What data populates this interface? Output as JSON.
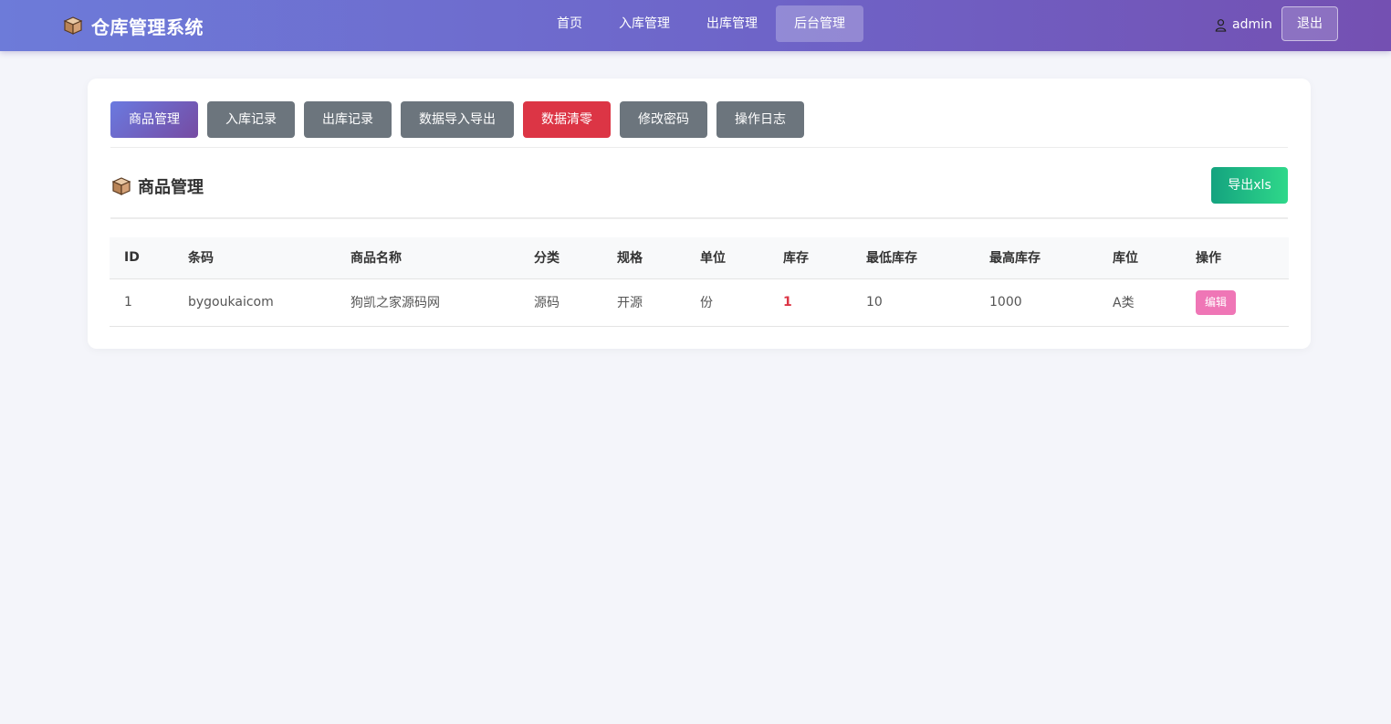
{
  "header": {
    "brand": "仓库管理系统",
    "nav": [
      "首页",
      "入库管理",
      "出库管理",
      "后台管理"
    ],
    "active_nav": "后台管理",
    "username": "admin",
    "logout": "退出"
  },
  "tabs": [
    {
      "label": "商品管理",
      "style": "active"
    },
    {
      "label": "入库记录",
      "style": "default"
    },
    {
      "label": "出库记录",
      "style": "default"
    },
    {
      "label": "数据导入导出",
      "style": "default"
    },
    {
      "label": "数据清零",
      "style": "danger"
    },
    {
      "label": "修改密码",
      "style": "default"
    },
    {
      "label": "操作日志",
      "style": "default"
    }
  ],
  "section": {
    "title": "商品管理",
    "export_label": "导出xls"
  },
  "table": {
    "columns": [
      "ID",
      "条码",
      "商品名称",
      "分类",
      "规格",
      "单位",
      "库存",
      "最低库存",
      "最高库存",
      "库位",
      "操作"
    ],
    "rows": [
      {
        "id": "1",
        "barcode": "bygoukaicom",
        "name": "狗凯之家源码网",
        "category": "源码",
        "spec": "开源",
        "unit": "份",
        "stock": "1",
        "min_stock": "10",
        "max_stock": "1000",
        "location": "A类",
        "action": "编辑"
      }
    ]
  },
  "colors": {
    "header_gradient_start": "#6d7bd9",
    "header_gradient_end": "#7450b2",
    "tab_default": "#6c757d",
    "tab_danger": "#dc3545",
    "export_green": "#20c07f",
    "edit_pink": "#ef76b6",
    "stock_alert": "#dc3545"
  }
}
